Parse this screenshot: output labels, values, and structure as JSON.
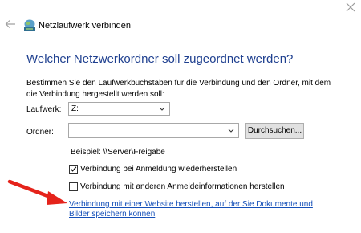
{
  "window": {
    "title": "Netzlaufwerk verbinden",
    "icons": {
      "back": "back-arrow-icon",
      "app": "network-drive-icon",
      "close": "close-icon"
    }
  },
  "main": {
    "heading": "Welcher Netzwerkordner soll zugeordnet werden?",
    "description": "Bestimmen Sie den Laufwerkbuchstaben für die Verbindung und den Ordner, mit dem die Verbindung hergestellt werden soll:"
  },
  "form": {
    "drive_label": "Laufwerk:",
    "drive_value": "Z:",
    "folder_label": "Ordner:",
    "folder_value": "",
    "browse_label": "Durchsuchen...",
    "example": "Beispiel: \\\\Server\\Freigabe",
    "reconnect_label": "Verbindung bei Anmeldung wiederherstellen",
    "reconnect_checked": true,
    "other_credentials_label": "Verbindung mit anderen Anmeldeinformationen herstellen",
    "other_credentials_checked": false,
    "website_link": "Verbindung mit einer Website herstellen, auf der Sie Dokumente und Bilder speichern können"
  },
  "colors": {
    "heading": "#1e3f8f",
    "link": "#1550b9",
    "annotation_arrow": "#e5231b"
  }
}
